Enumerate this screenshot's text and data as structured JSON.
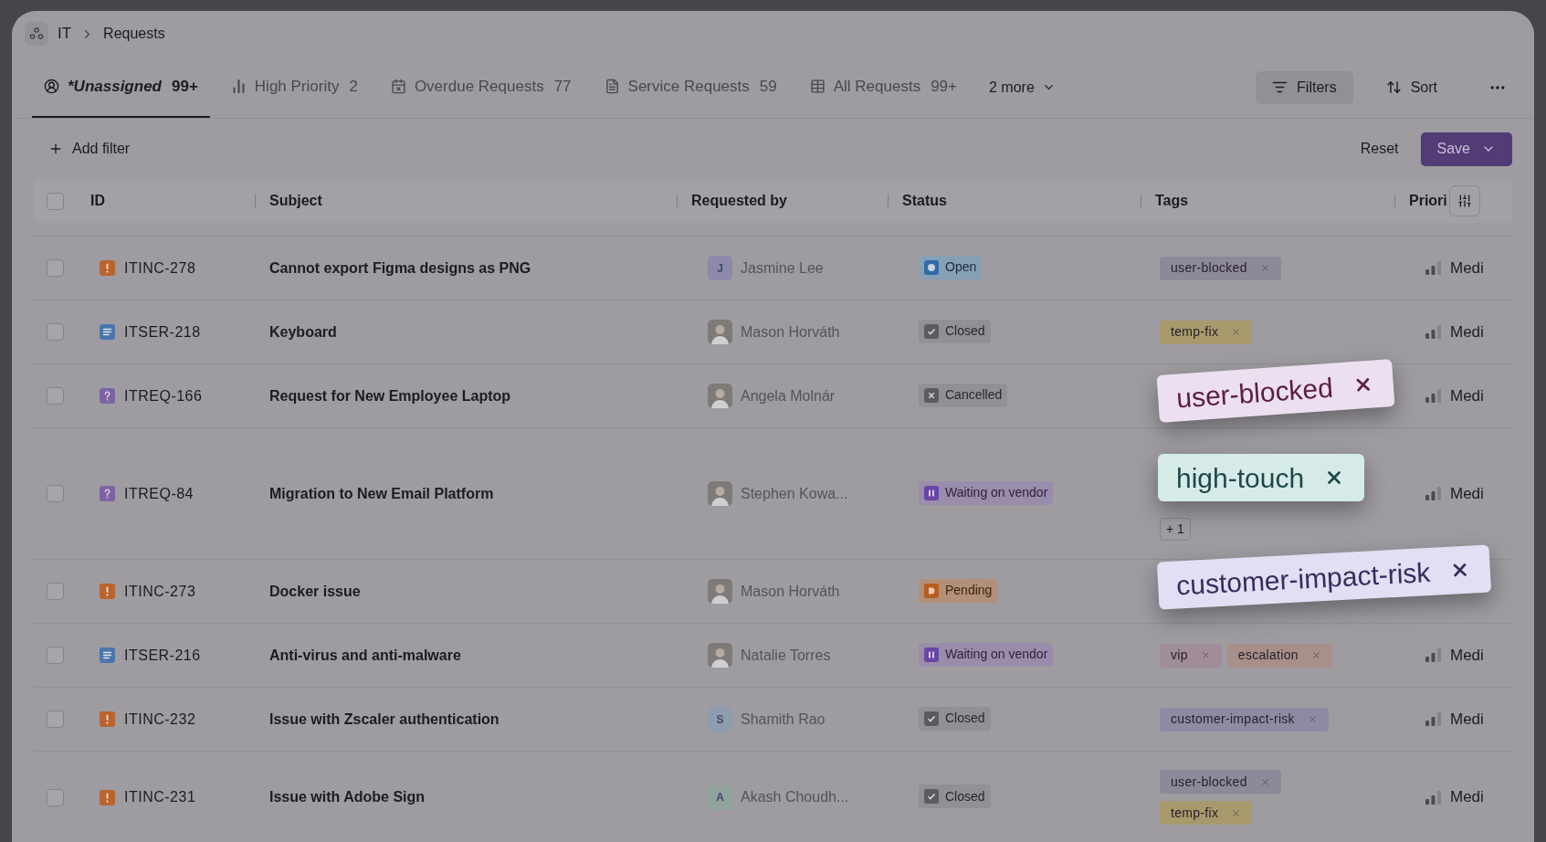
{
  "breadcrumb": [
    "IT",
    "Requests"
  ],
  "tabs": [
    {
      "label": "*Unassigned",
      "count": "99+",
      "kind": "user",
      "selected": true
    },
    {
      "label": "High Priority",
      "count": "2",
      "kind": "bars",
      "selected": false
    },
    {
      "label": "Overdue Requests",
      "count": "77",
      "kind": "calendar",
      "selected": false
    },
    {
      "label": "Service Requests",
      "count": "59",
      "kind": "doc",
      "selected": false
    },
    {
      "label": "All Requests",
      "count": "99+",
      "kind": "grid",
      "selected": false
    }
  ],
  "more_tabs": "2 more",
  "toolbar": {
    "filters": "Filters",
    "sort": "Sort",
    "add_filter": "Add filter",
    "reset": "Reset",
    "save": "Save"
  },
  "select_all_checked": false,
  "columns": [
    "ID",
    "Subject",
    "Requested by",
    "Status",
    "Tags",
    "Priori"
  ],
  "rows": [
    {
      "checked": false,
      "id": "ITINC-278",
      "kind": "incident",
      "subject": "Cannot export Figma designs as PNG",
      "requester": {
        "name": "Jasmine Lee",
        "kind": "initial",
        "initial": "J",
        "color": "#8c8aa8"
      },
      "status": {
        "label": "Open",
        "kind": "open"
      },
      "tag_lines": [
        [
          {
            "label": "user-blocked",
            "color": "#8e8999"
          }
        ]
      ],
      "priority": "Medi"
    },
    {
      "checked": false,
      "id": "ITSER-218",
      "kind": "service",
      "subject": "Keyboard",
      "requester": {
        "name": "Mason Horváth",
        "kind": "photo"
      },
      "status": {
        "label": "Closed",
        "kind": "closed"
      },
      "tag_lines": [
        [
          {
            "label": "temp-fix",
            "color": "#a8996c"
          }
        ]
      ],
      "priority": "Medi"
    },
    {
      "checked": false,
      "id": "ITREQ-166",
      "kind": "request",
      "subject": "Request for New Employee Laptop",
      "requester": {
        "name": "Angela Molnár",
        "kind": "photo"
      },
      "status": {
        "label": "Cancelled",
        "kind": "cancelled"
      },
      "tag_lines": [],
      "priority": "Medi"
    },
    {
      "checked": false,
      "id": "ITREQ-84",
      "kind": "request",
      "subject": "Migration to New Email Platform",
      "requester": {
        "name": "Stephen Kowa...",
        "kind": "photo"
      },
      "status": {
        "label": "Waiting on vendor",
        "kind": "waiting"
      },
      "tag_lines": [],
      "more": "+ 1",
      "priority": "Medi"
    },
    {
      "checked": false,
      "id": "ITINC-273",
      "kind": "incident",
      "subject": "Docker issue",
      "requester": {
        "name": "Mason Horváth",
        "kind": "photo"
      },
      "status": {
        "label": "Pending",
        "kind": "pending"
      },
      "tag_lines": []
    },
    {
      "checked": false,
      "id": "ITSER-216",
      "kind": "service",
      "subject": "Anti-virus and anti-malware",
      "requester": {
        "name": "Natalie Torres",
        "kind": "photo"
      },
      "status": {
        "label": "Waiting on vendor",
        "kind": "waiting"
      },
      "tag_lines": [
        [
          {
            "label": "vip",
            "color": "#a08d99"
          },
          {
            "label": "escalation",
            "color": "#a98f8a"
          }
        ]
      ],
      "priority": "Medi"
    },
    {
      "checked": false,
      "id": "ITINC-232",
      "kind": "incident",
      "subject": "Issue with Zscaler authentication",
      "requester": {
        "name": "Shamith Rao",
        "kind": "initial",
        "initial": "S",
        "color": "#8f9cb0"
      },
      "status": {
        "label": "Closed",
        "kind": "closed"
      },
      "tag_lines": [
        [
          {
            "label": "customer-impact-risk",
            "color": "#8d8ba2"
          }
        ]
      ],
      "priority": "Medi"
    },
    {
      "checked": false,
      "id": "ITINC-231",
      "kind": "incident",
      "subject": "Issue with Adobe Sign",
      "requester": {
        "name": "Akash Choudh...",
        "kind": "initial",
        "initial": "A",
        "color": "#8ea39c"
      },
      "status": {
        "label": "Closed",
        "kind": "closed"
      },
      "tag_lines": [
        [
          {
            "label": "user-blocked",
            "color": "#8e8999"
          }
        ],
        [
          {
            "label": "temp-fix",
            "color": "#a8996c"
          }
        ]
      ],
      "priority": "Medi"
    }
  ],
  "floating_tags": [
    {
      "label": "user-blocked",
      "color": "#ecdff0"
    },
    {
      "label": "high-touch",
      "color": "#d6ebe8"
    },
    {
      "label": "customer-impact-risk",
      "color": "#e0dff3"
    }
  ]
}
